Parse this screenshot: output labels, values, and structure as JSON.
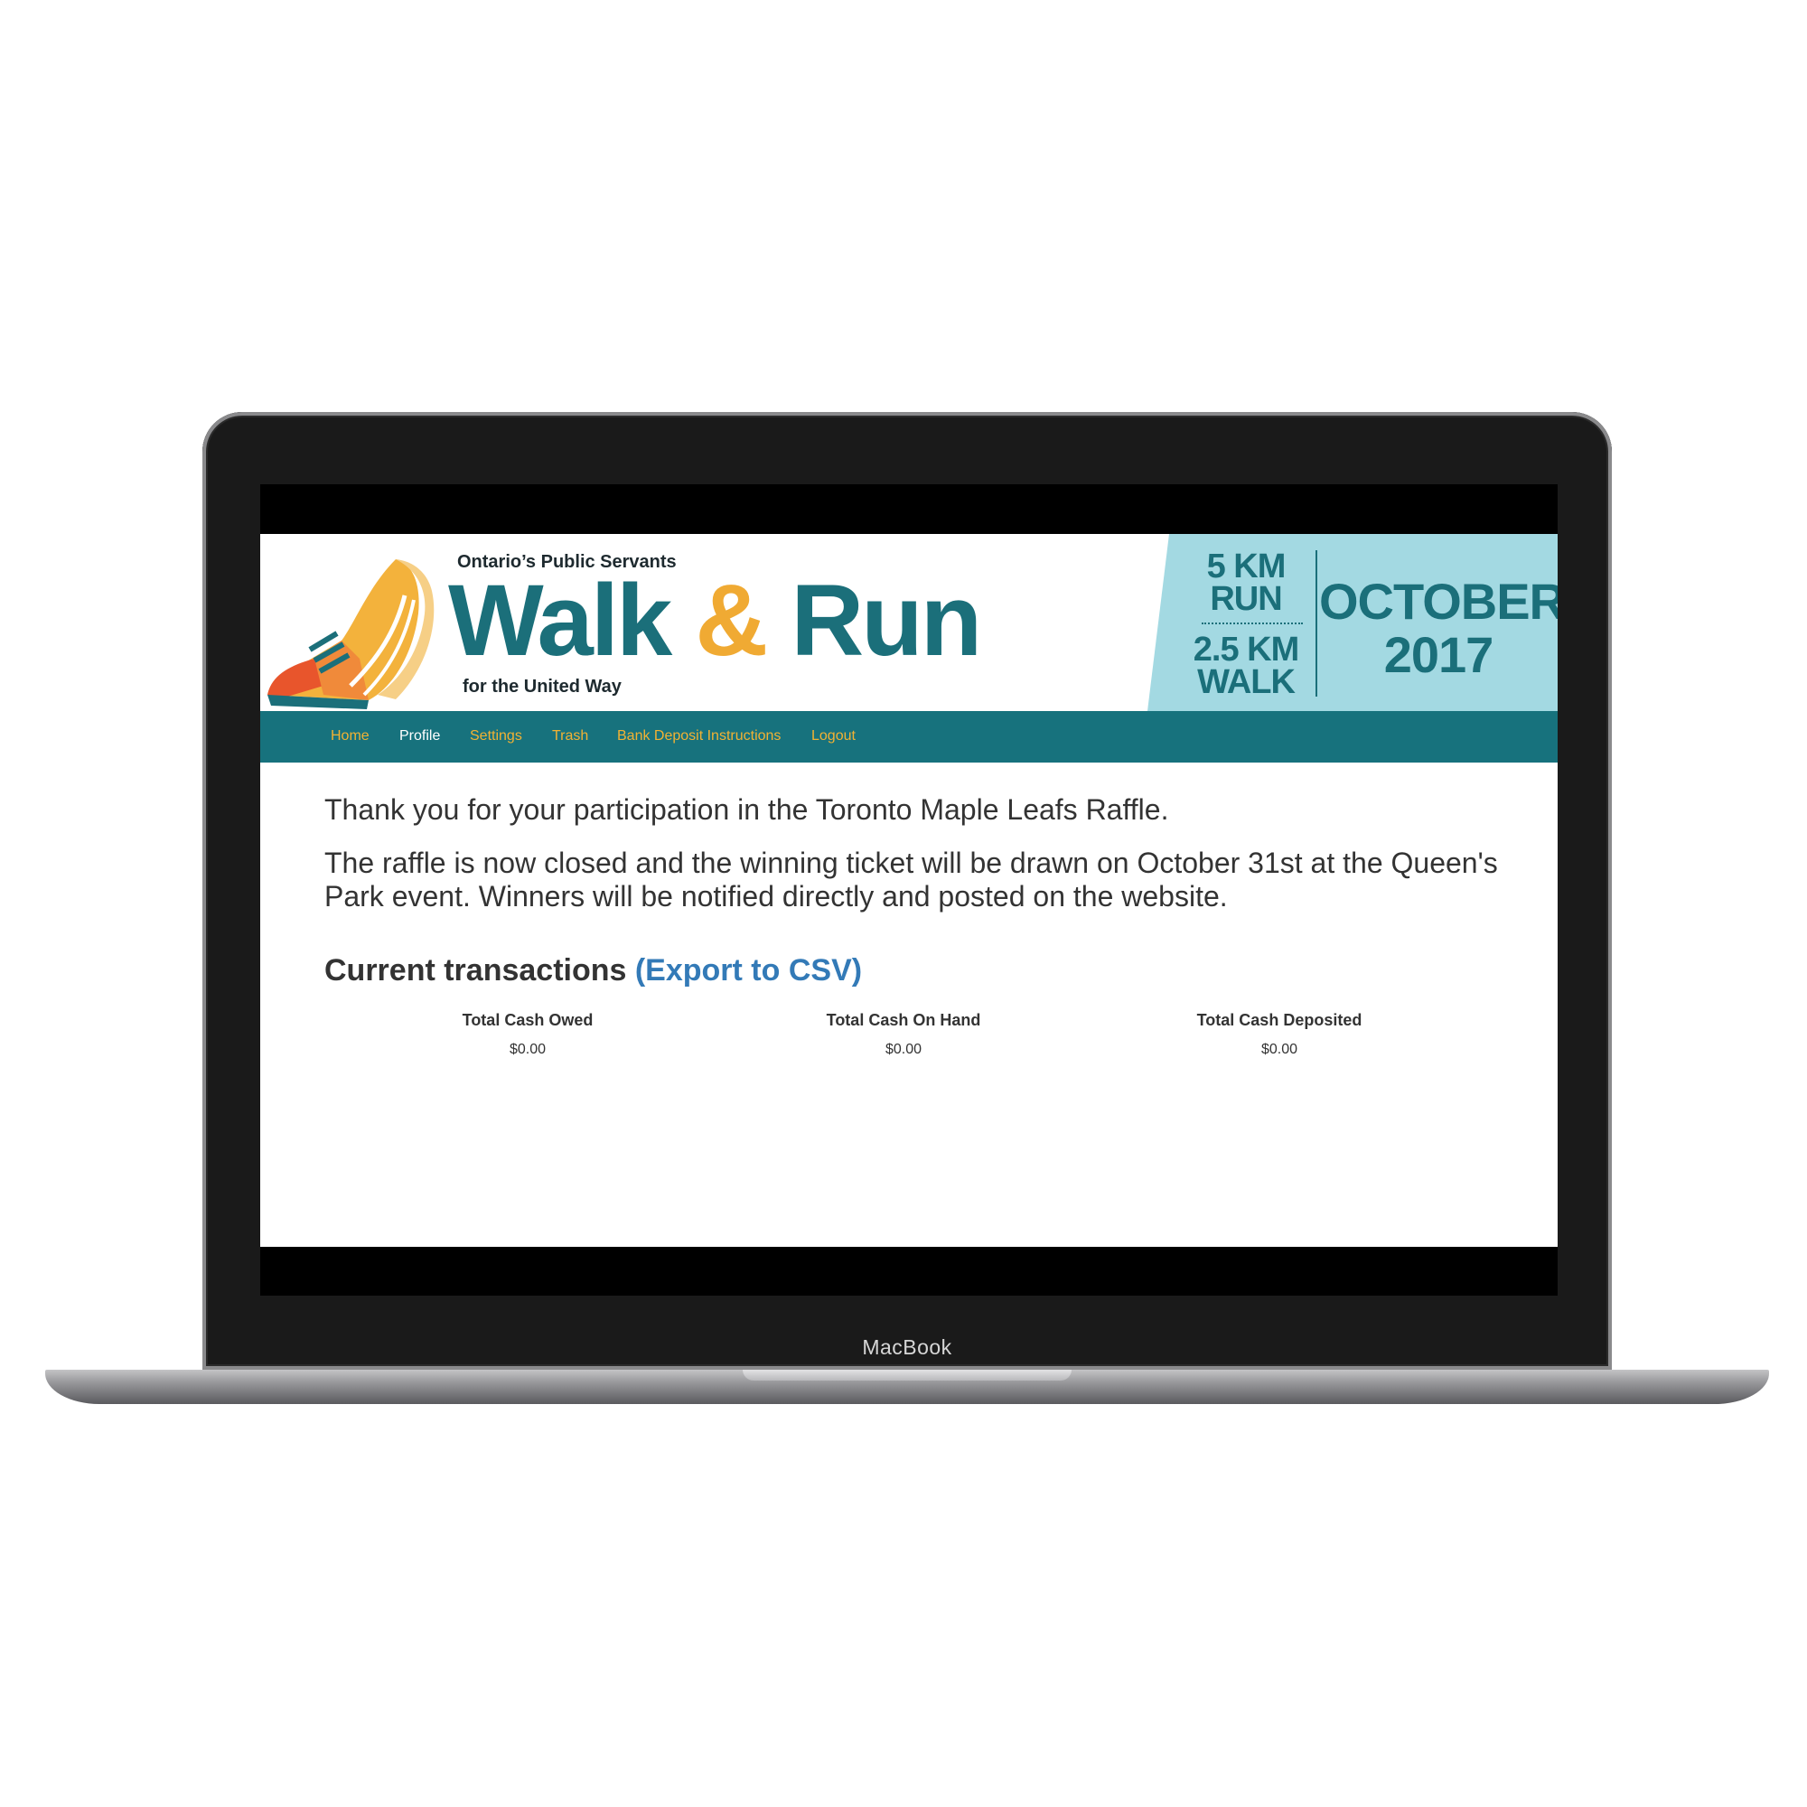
{
  "device": {
    "label": "MacBook"
  },
  "banner": {
    "org": "Ontario’s Public Servants",
    "title_walk": "Walk",
    "title_amp": "&",
    "title_run": "Run",
    "subline": "for the United Way",
    "run_distance": "5 KM",
    "run_label": "RUN",
    "walk_distance": "2.5 KM",
    "walk_label": "WALK",
    "month": "OCTOBER",
    "year": "2017",
    "colors": {
      "teal": "#1b6f7a",
      "orange": "#f0aa33",
      "light_blue": "#a3d9e2"
    }
  },
  "nav": {
    "items": [
      {
        "label": "Home"
      },
      {
        "label": "Profile",
        "active": true
      },
      {
        "label": "Settings"
      },
      {
        "label": "Trash"
      },
      {
        "label": "Bank Deposit Instructions"
      },
      {
        "label": "Logout"
      }
    ]
  },
  "main": {
    "thanks": "Thank you for your participation in the Toronto Maple Leafs Raffle.",
    "notice": "The raffle is now closed and the winning ticket will be drawn on October 31st at the Queen's Park event. Winners will be notified directly and posted on the website.",
    "transactions_heading": "Current transactions",
    "export_link": "(Export to CSV)",
    "totals": [
      {
        "label": "Total Cash Owed",
        "value": "$0.00"
      },
      {
        "label": "Total Cash On Hand",
        "value": "$0.00"
      },
      {
        "label": "Total Cash Deposited",
        "value": "$0.00"
      }
    ]
  }
}
